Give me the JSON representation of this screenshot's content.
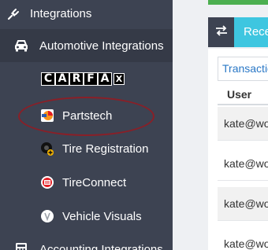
{
  "sidebar": {
    "integrations_label": "Integrations",
    "automotive_label": "Automotive Integrations",
    "carfax_letters": [
      "C",
      "A",
      "R",
      "F",
      "A"
    ],
    "carfax_x": "X",
    "items": [
      {
        "label": "Partstech",
        "icon": "partstech-logo-icon"
      },
      {
        "label": "Tire Registration",
        "icon": "tire-registration-icon"
      },
      {
        "label": "TireConnect",
        "icon": "tireconnect-icon"
      },
      {
        "label": "Vehicle Visuals",
        "icon": "vehicle-visuals-icon"
      }
    ],
    "accounting_label": "Accounting Integrations"
  },
  "main": {
    "tab_label": "Recent",
    "transactions_tab": "Transactions",
    "column_user": "User",
    "rows": [
      {
        "user": "kate@workshop"
      },
      {
        "user": "kate@workshop"
      },
      {
        "user": "kate@workshop"
      },
      {
        "user": "kate@workshop"
      }
    ]
  },
  "colors": {
    "sidebar_bg": "#3d4352",
    "sidebar_active_bg": "#353a47",
    "accent_cyan": "#3ec6e0",
    "accent_green": "#4caf50",
    "highlight_ellipse": "#8a1f27",
    "link_blue": "#2a78c6"
  }
}
